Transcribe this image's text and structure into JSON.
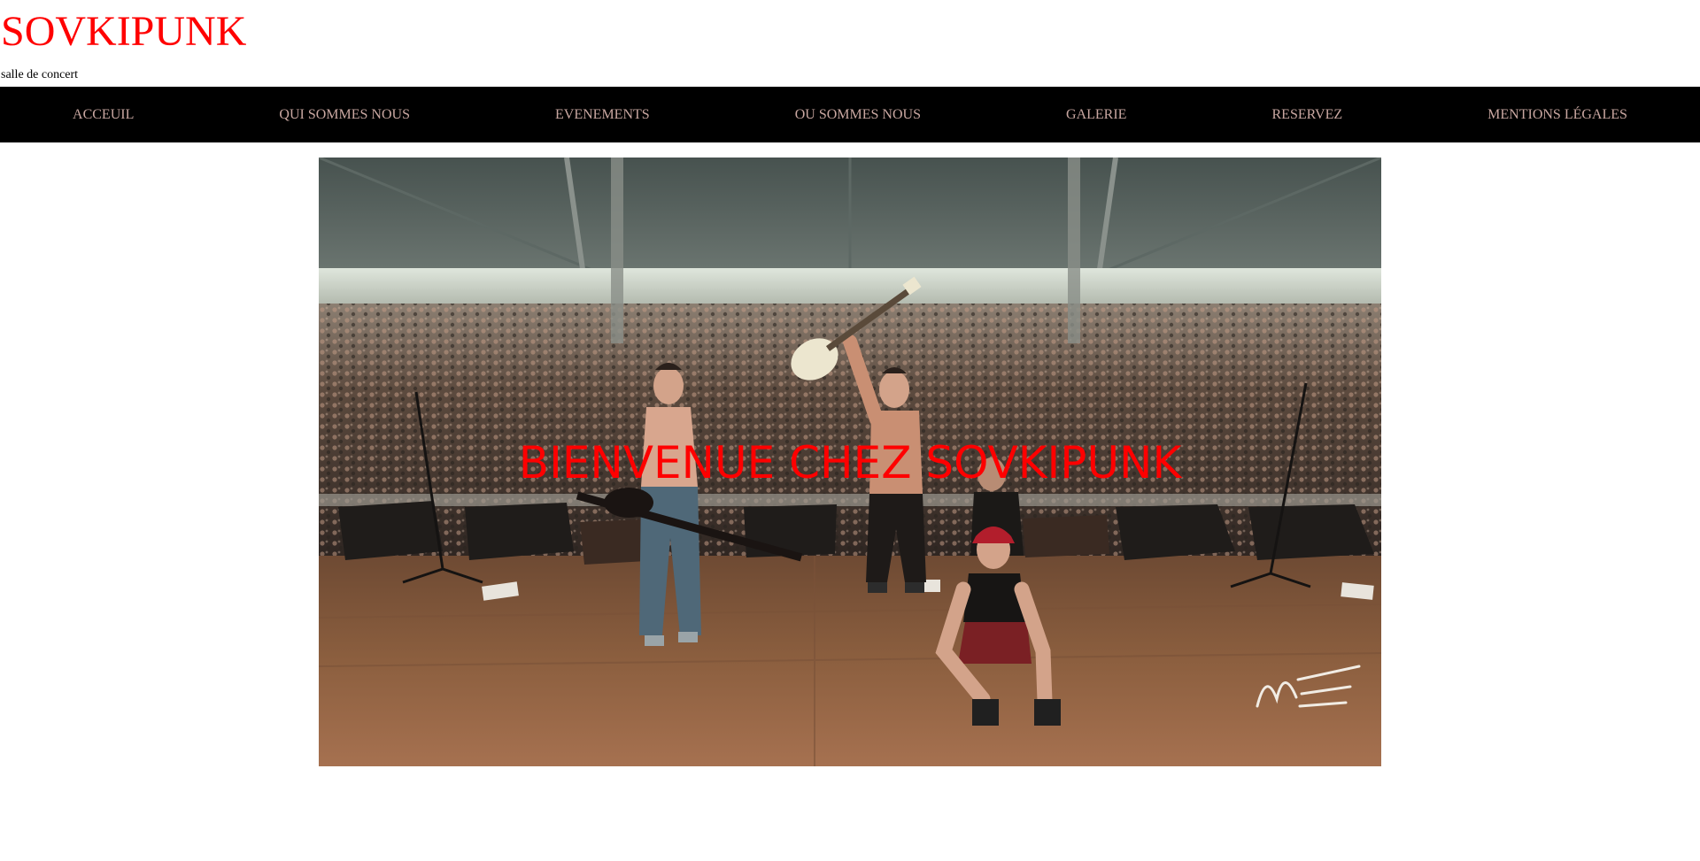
{
  "header": {
    "title": "SOVKIPUNK",
    "tagline": "salle de concert"
  },
  "nav": {
    "items": [
      {
        "label": "ACCEUIL"
      },
      {
        "label": "QUI SOMMES NOUS"
      },
      {
        "label": "EVENEMENTS"
      },
      {
        "label": "OU SOMMES NOUS"
      },
      {
        "label": "GALERIE"
      },
      {
        "label": "RESERVEZ"
      },
      {
        "label": "MENTIONS LÉGALES"
      }
    ]
  },
  "hero": {
    "heading": "BIENVENUE CHEZ SOVKIPUNK",
    "image_description": "band on stage in front of a large festival crowd under a tent",
    "signature_text": "ME"
  },
  "colors": {
    "title": "#ff0000",
    "nav_background": "#000000",
    "nav_text": "#c9a7a1",
    "hero_heading": "#ff0000"
  }
}
